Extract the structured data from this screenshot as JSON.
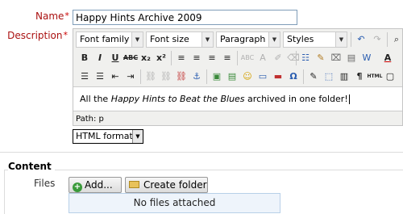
{
  "form": {
    "name_label": "Name",
    "description_label": "Description",
    "required_mark": "*",
    "name_value": "Happy Hints Archive 2009"
  },
  "editor": {
    "font_family": "Font family",
    "font_size": "Font size",
    "format": "Paragraph",
    "styles": "Styles",
    "content_prefix": "All the ",
    "content_italic": "Happy Hints to Beat the Blues",
    "content_suffix": " archived in one folder!",
    "path": "Path: p",
    "row2_buttons": [
      "B",
      "I",
      "U",
      "ABC",
      "x₂",
      "x²",
      "≡",
      "≡",
      "≡",
      "≡",
      "ABC",
      "A",
      "✐",
      "⌫",
      "☷",
      "A"
    ],
    "row3_buttons": [
      "☰",
      "☰",
      "⇤",
      "⇥",
      "⛓",
      "⛓",
      "⚓",
      "▣",
      "▤",
      "☺",
      "▭",
      "▬",
      "Ω",
      "✎",
      "⬚",
      "▥",
      "¶",
      "HTML",
      "▢"
    ],
    "html_label": "HTML"
  },
  "format_select": {
    "value": "HTML format"
  },
  "content_section": {
    "legend": "Content",
    "files_label": "Files",
    "add_label": "Add...",
    "create_folder_label": "Create folder",
    "no_files_text": "No files attached"
  }
}
